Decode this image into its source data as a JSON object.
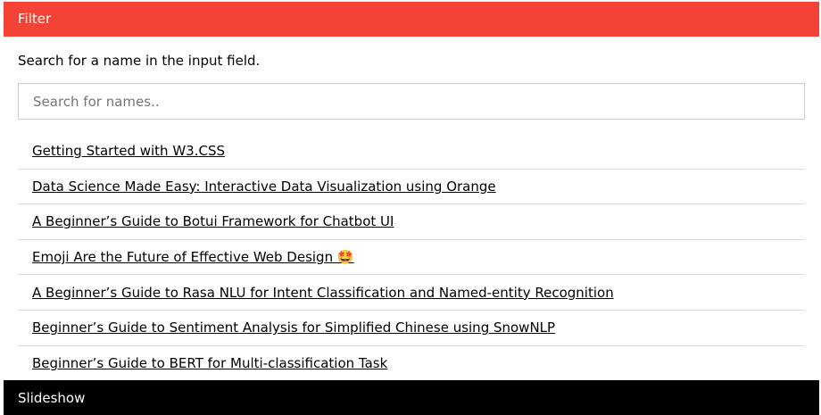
{
  "filter_header": {
    "title": "Filter",
    "color": "#f44336"
  },
  "instructions": "Search for a name in the input field.",
  "search": {
    "placeholder": "Search for names..",
    "value": ""
  },
  "articles": [
    {
      "title": "Getting Started with W3.CSS"
    },
    {
      "title": "Data Science Made Easy: Interactive Data Visualization using Orange"
    },
    {
      "title": "A Beginner’s Guide to Botui Framework for Chatbot UI"
    },
    {
      "title": "Emoji Are the Future of Effective Web Design 🤩"
    },
    {
      "title": "A Beginner’s Guide to Rasa NLU for Intent Classification and Named-entity Recognition"
    },
    {
      "title": "Beginner’s Guide to Sentiment Analysis for Simplified Chinese using SnowNLP"
    },
    {
      "title": "Beginner’s Guide to BERT for Multi-classification Task"
    }
  ],
  "slideshow_bar": {
    "title": "Slideshow",
    "color": "#000000"
  }
}
